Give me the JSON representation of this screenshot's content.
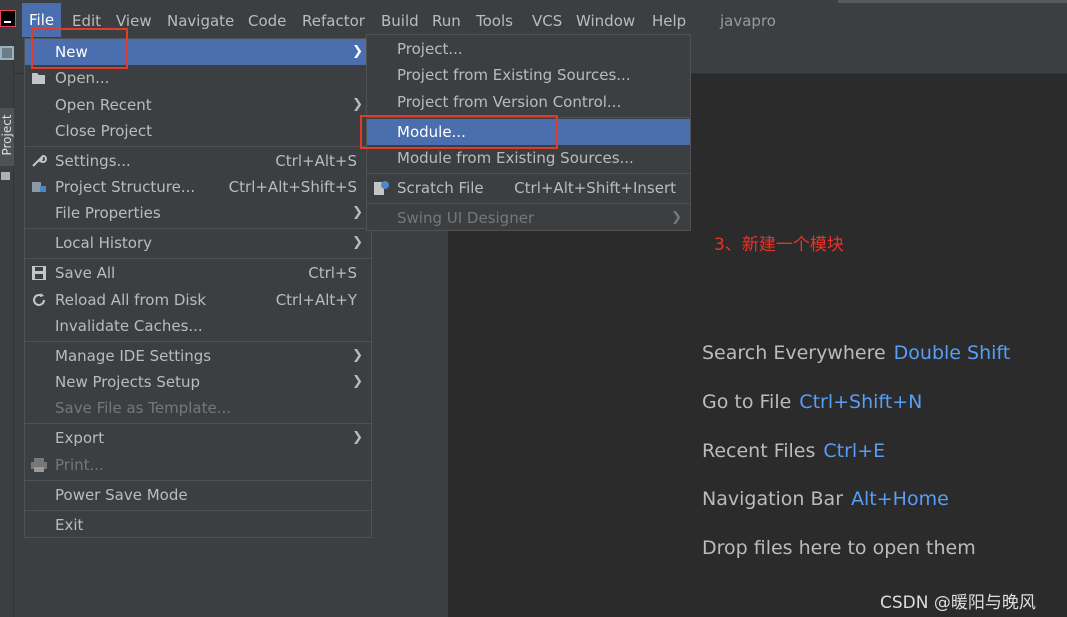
{
  "menubar": {
    "items": [
      "File",
      "Edit",
      "View",
      "Navigate",
      "Code",
      "Refactor",
      "Build",
      "Run",
      "Tools",
      "VCS",
      "Window",
      "Help"
    ],
    "project_name": "javapro"
  },
  "left_strip": {
    "tab_label": "Project"
  },
  "file_menu": {
    "items": [
      {
        "label": "New",
        "shortcut": "",
        "submenu": true
      },
      {
        "label": "Open...",
        "shortcut": "",
        "submenu": false
      },
      {
        "label": "Open Recent",
        "shortcut": "",
        "submenu": true
      },
      {
        "label": "Close Project",
        "shortcut": "",
        "submenu": false
      },
      {
        "label": "Settings...",
        "shortcut": "Ctrl+Alt+S",
        "submenu": false
      },
      {
        "label": "Project Structure...",
        "shortcut": "Ctrl+Alt+Shift+S",
        "submenu": false
      },
      {
        "label": "File Properties",
        "shortcut": "",
        "submenu": true
      },
      {
        "label": "Local History",
        "shortcut": "",
        "submenu": true
      },
      {
        "label": "Save All",
        "shortcut": "Ctrl+S",
        "submenu": false
      },
      {
        "label": "Reload All from Disk",
        "shortcut": "Ctrl+Alt+Y",
        "submenu": false
      },
      {
        "label": "Invalidate Caches...",
        "shortcut": "",
        "submenu": false
      },
      {
        "label": "Manage IDE Settings",
        "shortcut": "",
        "submenu": true
      },
      {
        "label": "New Projects Setup",
        "shortcut": "",
        "submenu": true
      },
      {
        "label": "Save File as Template...",
        "shortcut": "",
        "submenu": false
      },
      {
        "label": "Export",
        "shortcut": "",
        "submenu": true
      },
      {
        "label": "Print...",
        "shortcut": "",
        "submenu": false
      },
      {
        "label": "Power Save Mode",
        "shortcut": "",
        "submenu": false
      },
      {
        "label": "Exit",
        "shortcut": "",
        "submenu": false
      }
    ]
  },
  "new_submenu": {
    "items": [
      {
        "label": "Project...",
        "shortcut": ""
      },
      {
        "label": "Project from Existing Sources...",
        "shortcut": ""
      },
      {
        "label": "Project from Version Control...",
        "shortcut": ""
      },
      {
        "label": "Module...",
        "shortcut": ""
      },
      {
        "label": "Module from Existing Sources...",
        "shortcut": ""
      },
      {
        "label": "Scratch File",
        "shortcut": "Ctrl+Alt+Shift+Insert"
      },
      {
        "label": "Swing UI Designer",
        "shortcut": ""
      }
    ]
  },
  "annotation": "3、新建一个模块",
  "hints": [
    {
      "text": "Search Everywhere",
      "key": "Double Shift"
    },
    {
      "text": "Go to File",
      "key": "Ctrl+Shift+N"
    },
    {
      "text": "Recent Files",
      "key": "Ctrl+E"
    },
    {
      "text": "Navigation Bar",
      "key": "Alt+Home"
    },
    {
      "text": "Drop files here to open them",
      "key": ""
    }
  ],
  "watermark": "CSDN @暖阳与晚风",
  "colors": {
    "selection": "#4b6eaf",
    "annotation": "#e8332a",
    "hint_key": "#589df6",
    "menu_bg": "#3c3f41"
  }
}
